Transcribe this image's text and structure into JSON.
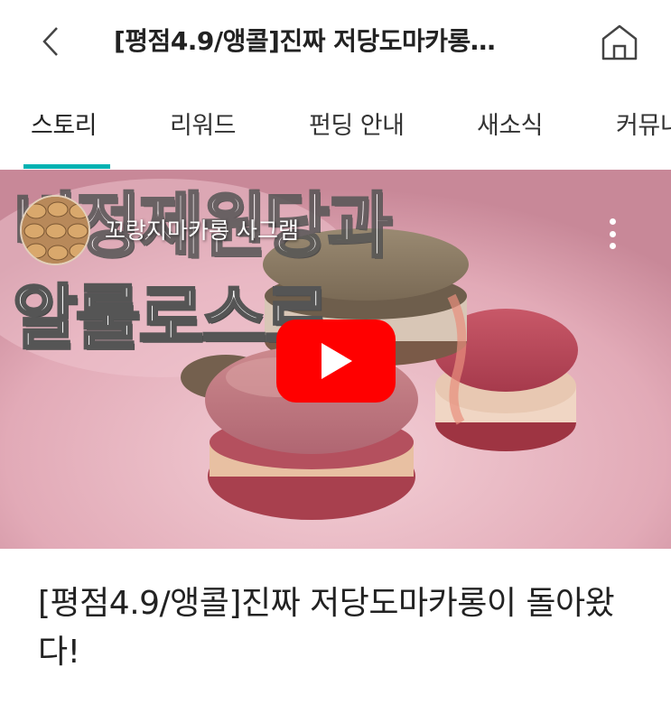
{
  "header": {
    "title": "[평점4.9/앵콜]진짜 저당도마카롱…",
    "back_icon": "chevron-left-icon",
    "home_icon": "home-icon"
  },
  "tabs": [
    {
      "label": "스토리",
      "active": true
    },
    {
      "label": "리워드",
      "active": false
    },
    {
      "label": "펀딩 안내",
      "active": false
    },
    {
      "label": "새소식",
      "active": false
    },
    {
      "label": "커뮤니",
      "active": false
    }
  ],
  "colors": {
    "accent": "#00b2b2",
    "play_button": "#ff0000"
  },
  "video": {
    "channel_name": "꼬랑지마카롱 사그램",
    "overlay_line1": "비정제원당과",
    "overlay_line2": "알룰로스로",
    "play_icon": "play-icon",
    "more_icon": "more-vertical-icon"
  },
  "story": {
    "headline": "[평점4.9/앵콜]진짜 저당도마카롱이 돌아왔다!"
  }
}
